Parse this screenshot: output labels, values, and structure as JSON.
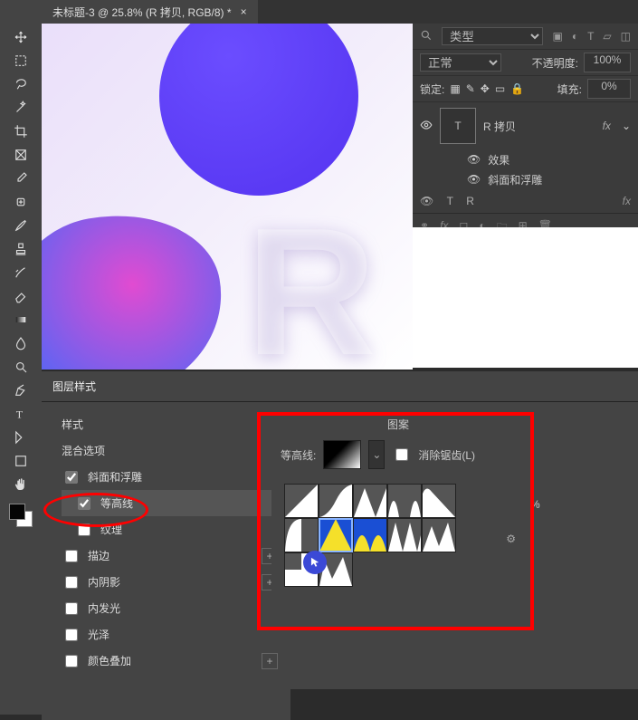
{
  "tab": {
    "title": "未标题-3 @ 25.8% (R 拷贝, RGB/8) *",
    "close": "×"
  },
  "rightPanel": {
    "search": "类型",
    "blend": "正常",
    "opacityLabel": "不透明度:",
    "opacity": "100%",
    "lockLabel": "锁定:",
    "fillLabel": "填充:",
    "fill": "0%",
    "layerName": "R 拷贝",
    "fx": "fx",
    "effects": "效果",
    "bevel": "斜面和浮雕",
    "layer2": "R"
  },
  "layerStyle": {
    "title": "图层样式",
    "styles": "样式",
    "blendOptions": "混合选项",
    "bevel": "斜面和浮雕",
    "contour": "等高线",
    "texture": "纹理",
    "stroke": "描边",
    "innerShadow": "内阴影",
    "innerGlow": "内发光",
    "satin": "光泽",
    "colorOverlay": "颜色叠加",
    "contourSection": {
      "pattern": "图案",
      "label": "等高线:",
      "antialias": "消除锯齿(L)",
      "range": "%"
    }
  }
}
